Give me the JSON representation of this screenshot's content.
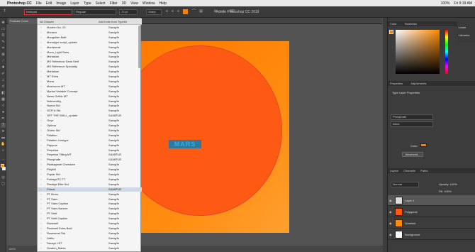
{
  "menubar": {
    "apple": "",
    "app": "Photoshop CC",
    "items": [
      "File",
      "Edit",
      "Image",
      "Layer",
      "Type",
      "Select",
      "Filter",
      "3D",
      "View",
      "Window",
      "Help"
    ],
    "right": [
      "100%",
      "Fri 9:19 AM"
    ]
  },
  "options": {
    "font_value": "Notepad",
    "style_value": "Regular",
    "size_value": "72 pt",
    "aa_value": "Sharp"
  },
  "window_title": "Adobe Photoshop CC 2019",
  "doc_tab": "Podcast Cover",
  "status": "100%",
  "fontlist": {
    "filter_label": "All Classes",
    "typekit_label": "Add fonts from Typekit",
    "fonts": [
      {
        "name": "Modern No. 20",
        "sample": "Sample"
      },
      {
        "name": "Monaco",
        "sample": "Sample"
      },
      {
        "name": "Mongolian Baiti",
        "sample": "Sample"
      },
      {
        "name": "Monotype script_update",
        "sample": "Sample"
      },
      {
        "name": "Montserrat",
        "sample": "Sample"
      },
      {
        "name": "Moon_Light Sans",
        "sample": "Sample"
      },
      {
        "name": "Mshtakan",
        "sample": "Sample"
      },
      {
        "name": "MS Reference Sans Serif",
        "sample": "Sample"
      },
      {
        "name": "MS Reference Specialty",
        "sample": "Sample"
      },
      {
        "name": "Mshtakan",
        "sample": "Sample"
      },
      {
        "name": "MT Extra",
        "sample": "Sample"
      },
      {
        "name": "Muna",
        "sample": "Sample"
      },
      {
        "name": "Mushroom MT",
        "sample": "Sample"
      },
      {
        "name": "Myriad Variable Concept",
        "sample": "Sample"
      },
      {
        "name": "News Gothic MT",
        "sample": "Sample"
      },
      {
        "name": "Noteworthy",
        "sample": "Sample"
      },
      {
        "name": "Nueva Std",
        "sample": "Sample"
      },
      {
        "name": "OCR A Std",
        "sample": "Sample"
      },
      {
        "name": "OFF THE WALL_update",
        "sample": "SAMPLE"
      },
      {
        "name": "Onyx",
        "sample": "Sample"
      },
      {
        "name": "Optima",
        "sample": "Sample"
      },
      {
        "name": "Orator Std",
        "sample": "Sample"
      },
      {
        "name": "Palatino",
        "sample": "Sample"
      },
      {
        "name": "Palatino Linotype",
        "sample": "Sample"
      },
      {
        "name": "Papyrus",
        "sample": "Sample"
      },
      {
        "name": "Perpetua",
        "sample": "Sample"
      },
      {
        "name": "Perpetua Titling MT",
        "sample": "SAMPLE"
      },
      {
        "name": "Phosphate",
        "sample": "SAMPLE"
      },
      {
        "name": "Plantagenet Cherokee",
        "sample": "Sample"
      },
      {
        "name": "Playbill",
        "sample": "Sample"
      },
      {
        "name": "Poplar Std",
        "sample": "Sample"
      },
      {
        "name": "PortagoITC TT",
        "sample": "Sample"
      },
      {
        "name": "Prestige Elite Std",
        "sample": "Sample"
      },
      {
        "name": "Primal",
        "sample": "SAMPLE"
      },
      {
        "name": "PT Mono",
        "sample": "Sample"
      },
      {
        "name": "PT Sans",
        "sample": "Sample"
      },
      {
        "name": "PT Sans Caption",
        "sample": "Sample"
      },
      {
        "name": "PT Sans Narrow",
        "sample": "Sample"
      },
      {
        "name": "PT Serif",
        "sample": "Sample"
      },
      {
        "name": "PT Serif Caption",
        "sample": "Sample"
      },
      {
        "name": "Rockwell",
        "sample": "Sample"
      },
      {
        "name": "Rockwell Extra Bold",
        "sample": "Sample"
      },
      {
        "name": "Rosewood Std",
        "sample": "Sample"
      },
      {
        "name": "Sathu",
        "sample": "Sample"
      },
      {
        "name": "Savoye LET",
        "sample": "Sample"
      },
      {
        "name": "Scratch_Marks",
        "sample": "Sample"
      }
    ],
    "selected_index": 33
  },
  "panels": {
    "color_tabs": [
      "Color",
      "Swatches"
    ],
    "props_tabs": [
      "Properties",
      "Adjustments"
    ],
    "props_title": "Type Layer Properties",
    "char_font": "Phosphate",
    "char_style": "Inline",
    "color_label": "Color:",
    "advanced_btn": "Advanced...",
    "layers_tabs": [
      "Layers",
      "Channels",
      "Paths"
    ],
    "blend_mode": "Normal",
    "opacity": "Opacity: 100%",
    "fill": "Fill: 100%",
    "layers": [
      {
        "name": "Layer 1",
        "thumb": "#dcdcdc"
      },
      {
        "name": "Polygonal",
        "thumb": "#ff5a14"
      },
      {
        "name": "Gradient",
        "thumb": "#ff8c10"
      },
      {
        "name": "Background",
        "thumb": "#ffffff"
      }
    ]
  },
  "side_buttons": [
    "Learn",
    "Libraries"
  ],
  "canvas_text": "MARS",
  "colors": {
    "accent": "#ff8000",
    "circle": "#ff5a14",
    "text_box": "#2d7aa0"
  }
}
